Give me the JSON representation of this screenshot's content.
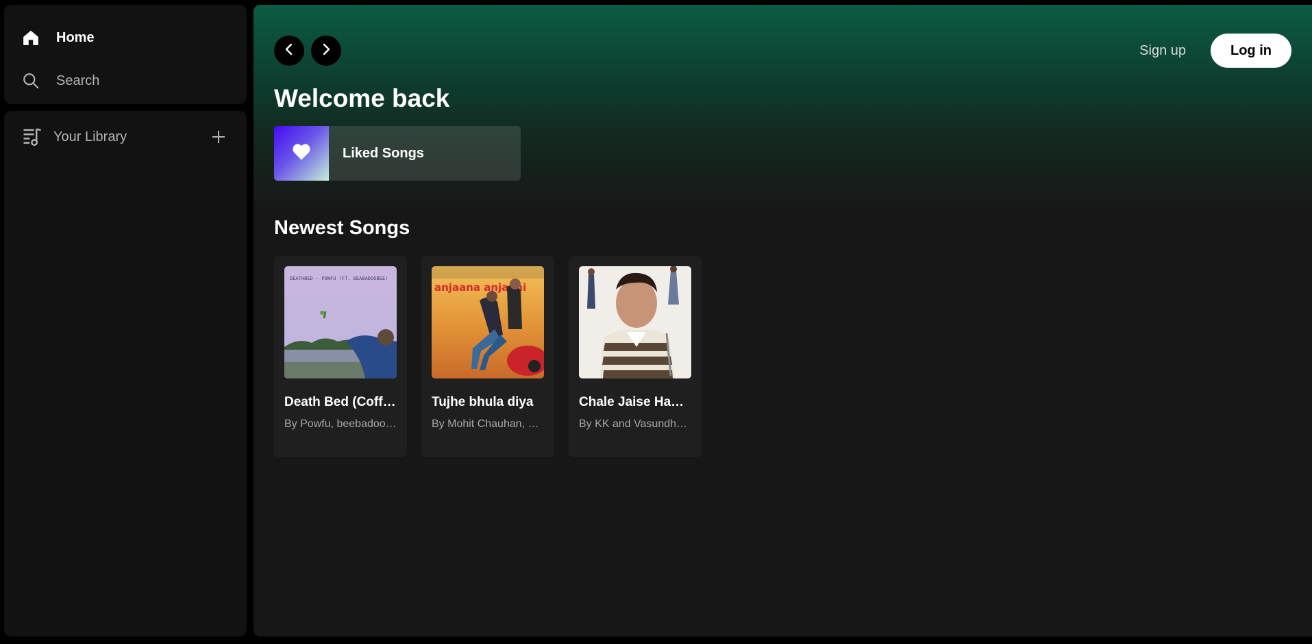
{
  "sidebar": {
    "nav": {
      "home_label": "Home",
      "home_icon": "home-icon",
      "search_label": "Search",
      "search_icon": "search-icon"
    },
    "library": {
      "label": "Your Library",
      "icon": "library-icon",
      "add_icon": "plus-icon"
    }
  },
  "topbar": {
    "back_icon": "chevron-left-icon",
    "forward_icon": "chevron-right-icon",
    "signup_label": "Sign up",
    "login_label": "Log in"
  },
  "main": {
    "welcome": "Welcome back",
    "liked": {
      "label": "Liked Songs",
      "icon": "heart-icon"
    },
    "newest_title": "Newest Songs",
    "songs": [
      {
        "title": "Death Bed (Coffee for Your Head)",
        "artist": "By Powfu, beebadoobee",
        "cover_text": "DEATHBED · POWFU (FT. BEABADOOBEE)"
      },
      {
        "title": "Tujhe bhula diya",
        "artist": "By Mohit Chauhan, Shekhar Ravjiani",
        "cover_text": "anjaana anjaani"
      },
      {
        "title": "Chale Jaise Hawaien",
        "artist": "By KK and Vasundhara Das",
        "cover_text": ""
      }
    ]
  },
  "colors": {
    "accent_green": "#0c5c45",
    "sidebar_bg": "#121212",
    "main_bg": "#171717",
    "card_bg": "#1f1f1f"
  }
}
